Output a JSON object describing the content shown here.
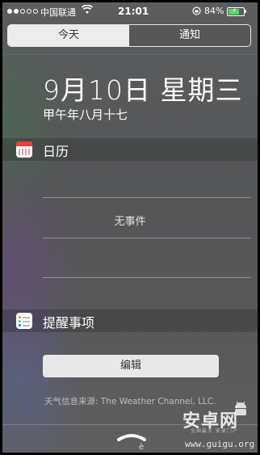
{
  "status_bar": {
    "carrier": "中国联通",
    "time": "21:01",
    "battery_percent": "84%",
    "battery_level": 0.84,
    "signal_strength": 2,
    "signal_total": 5
  },
  "tabs": [
    {
      "label": "今天",
      "active": true
    },
    {
      "label": "通知",
      "active": false
    }
  ],
  "date": {
    "main": "9月10日 星期三",
    "lunar": "甲午年八月十七"
  },
  "calendar": {
    "title": "日历",
    "empty_text": "无事件"
  },
  "reminders": {
    "title": "提醒事项"
  },
  "edit_button": "编辑",
  "weather_source": "天气信息来源: The Weather Channel, LLC.",
  "bottom_mark": "è",
  "watermark": {
    "logo": "安卓网",
    "small": "全国最大 安卓门户",
    "url": "www.guigu.org"
  },
  "colors": {
    "battery_fill": "#4cd964",
    "calendar_accent": "#ff3b30"
  }
}
